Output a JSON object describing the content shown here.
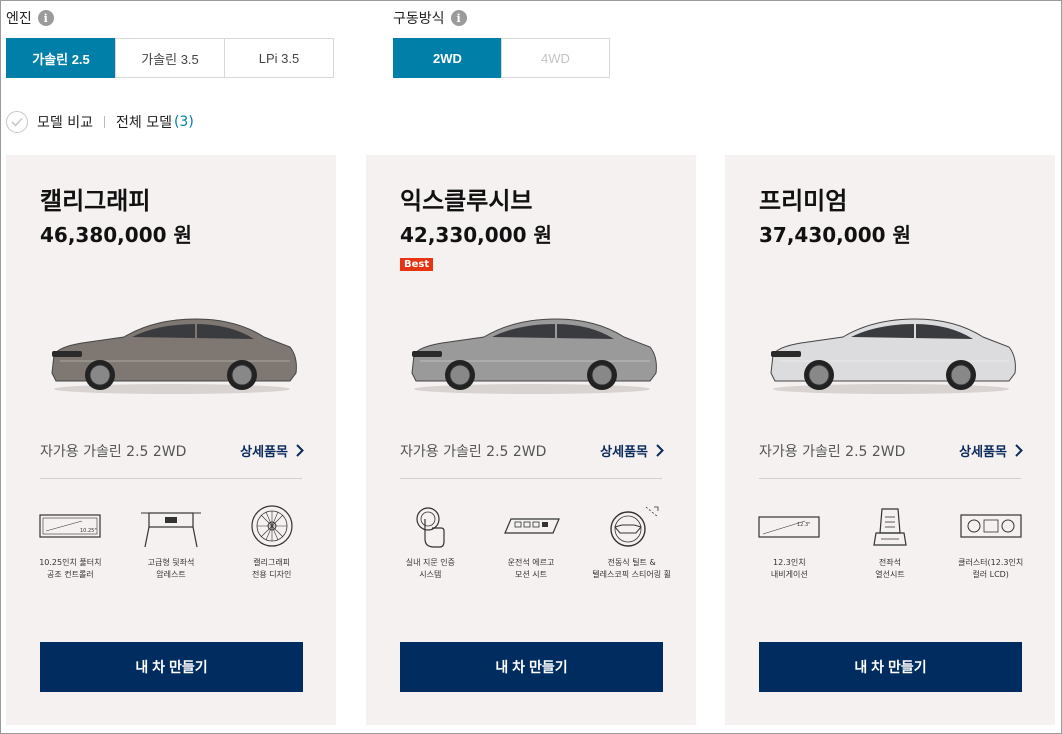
{
  "engine": {
    "label": "엔진",
    "options": [
      "가솔린 2.5",
      "가솔린 3.5",
      "LPi 3.5"
    ],
    "selected": "가솔린 2.5"
  },
  "drive": {
    "label": "구동방식",
    "options": [
      "2WD",
      "4WD"
    ],
    "selected": "2WD",
    "disabled": "4WD"
  },
  "compare": {
    "label": "모델 비교",
    "all_label": "전체 모델",
    "count": "(3)"
  },
  "colors": {
    "accent": "#007fa8",
    "cta": "#002c5f",
    "card_bg": "#f5f1f0",
    "badge": "#e63312"
  },
  "models": [
    {
      "name": "캘리그래피",
      "price": "46,380,000 원",
      "badge": "",
      "car_color": "#7f7872",
      "trim": "자가용 가솔린 2.5 2WD",
      "detail_label": "상세품목",
      "features": [
        {
          "icon": "touch-screen-icon",
          "label": "10.25인치 풀터치\n공조 컨트롤러"
        },
        {
          "icon": "rear-armrest-icon",
          "label": "고급형 뒷좌석\n암레스트"
        },
        {
          "icon": "wheel-icon",
          "label": "캘리그래피\n전용 디자인"
        }
      ],
      "cta": "내 차 만들기"
    },
    {
      "name": "익스클루시브",
      "price": "42,330,000 원",
      "badge": "Best",
      "car_color": "#9a9a9b",
      "trim": "자가용 가솔린 2.5 2WD",
      "detail_label": "상세품목",
      "features": [
        {
          "icon": "fingerprint-icon",
          "label": "실내 지문 인증\n시스템"
        },
        {
          "icon": "seat-control-icon",
          "label": "운전석 에르고\n모션 시트"
        },
        {
          "icon": "steering-wheel-icon",
          "label": "전동식 틸트 &\n텔레스코픽 스티어링 휠"
        }
      ],
      "cta": "내 차 만들기"
    },
    {
      "name": "프리미엄",
      "price": "37,430,000 원",
      "badge": "",
      "car_color": "#dcdcde",
      "trim": "자가용 가솔린 2.5 2WD",
      "detail_label": "상세품목",
      "features": [
        {
          "icon": "navigation-screen-icon",
          "label": "12.3인치\n내비게이션"
        },
        {
          "icon": "heated-seat-icon",
          "label": "전좌석\n열선시트"
        },
        {
          "icon": "cluster-icon",
          "label": "클러스터(12.3인치\n컬러 LCD)"
        }
      ],
      "cta": "내 차 만들기"
    }
  ]
}
